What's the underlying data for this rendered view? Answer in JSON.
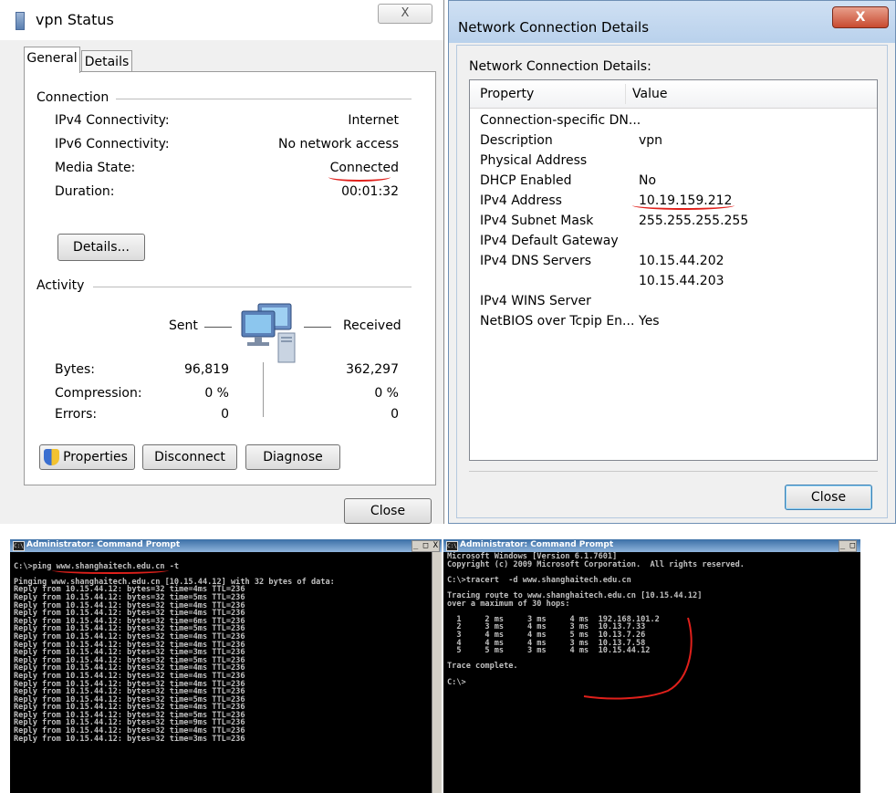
{
  "vpn_status": {
    "title": "vpn Status",
    "close_x": "X",
    "tabs": [
      "General",
      "Details"
    ],
    "connection": {
      "group_label": "Connection",
      "rows": [
        {
          "label": "IPv4 Connectivity:",
          "value": "Internet"
        },
        {
          "label": "IPv6 Connectivity:",
          "value": "No network access"
        },
        {
          "label": "Media State:",
          "value": "Connected"
        },
        {
          "label": "Duration:",
          "value": "00:01:32"
        }
      ],
      "details_button": "Details..."
    },
    "activity": {
      "group_label": "Activity",
      "sent_label": "Sent",
      "received_label": "Received",
      "rows": [
        {
          "label": "Bytes:",
          "sent": "96,819",
          "received": "362,297"
        },
        {
          "label": "Compression:",
          "sent": "0 %",
          "received": "0 %"
        },
        {
          "label": "Errors:",
          "sent": "0",
          "received": "0"
        }
      ]
    },
    "buttons": {
      "properties": "Properties",
      "disconnect": "Disconnect",
      "diagnose": "Diagnose",
      "close": "Close"
    }
  },
  "network_details": {
    "title": "Network Connection Details",
    "close_x": "X",
    "subtitle": "Network Connection Details:",
    "columns": [
      "Property",
      "Value"
    ],
    "rows": [
      {
        "property": "Connection-specific DN...",
        "value": ""
      },
      {
        "property": "Description",
        "value": "vpn"
      },
      {
        "property": "Physical Address",
        "value": ""
      },
      {
        "property": "DHCP Enabled",
        "value": "No"
      },
      {
        "property": "IPv4 Address",
        "value": "10.19.159.212"
      },
      {
        "property": "IPv4 Subnet Mask",
        "value": "255.255.255.255"
      },
      {
        "property": "IPv4 Default Gateway",
        "value": ""
      },
      {
        "property": "IPv4 DNS Servers",
        "value": "10.15.44.202"
      },
      {
        "property": "",
        "value": "10.15.44.203"
      },
      {
        "property": "IPv4 WINS Server",
        "value": ""
      },
      {
        "property": "NetBIOS over Tcpip En...",
        "value": "Yes"
      }
    ],
    "close_button": "Close"
  },
  "console_left": {
    "title": "Administrator: Command Prompt",
    "window_buttons": "_ □ X",
    "lines": [
      "",
      "C:\\>ping www.shanghaitech.edu.cn -t",
      "",
      "Pinging www.shanghaitech.edu.cn [10.15.44.12] with 32 bytes of data:",
      "Reply from 10.15.44.12: bytes=32 time=4ms TTL=236",
      "Reply from 10.15.44.12: bytes=32 time=5ms TTL=236",
      "Reply from 10.15.44.12: bytes=32 time=4ms TTL=236",
      "Reply from 10.15.44.12: bytes=32 time=4ms TTL=236",
      "Reply from 10.15.44.12: bytes=32 time=6ms TTL=236",
      "Reply from 10.15.44.12: bytes=32 time=5ms TTL=236",
      "Reply from 10.15.44.12: bytes=32 time=4ms TTL=236",
      "Reply from 10.15.44.12: bytes=32 time=4ms TTL=236",
      "Reply from 10.15.44.12: bytes=32 time=3ms TTL=236",
      "Reply from 10.15.44.12: bytes=32 time=5ms TTL=236",
      "Reply from 10.15.44.12: bytes=32 time=4ms TTL=236",
      "Reply from 10.15.44.12: bytes=32 time=4ms TTL=236",
      "Reply from 10.15.44.12: bytes=32 time=4ms TTL=236",
      "Reply from 10.15.44.12: bytes=32 time=4ms TTL=236",
      "Reply from 10.15.44.12: bytes=32 time=5ms TTL=236",
      "Reply from 10.15.44.12: bytes=32 time=4ms TTL=236",
      "Reply from 10.15.44.12: bytes=32 time=5ms TTL=236",
      "Reply from 10.15.44.12: bytes=32 time=9ms TTL=236",
      "Reply from 10.15.44.12: bytes=32 time=4ms TTL=236",
      "Reply from 10.15.44.12: bytes=32 time=3ms TTL=236"
    ]
  },
  "console_right": {
    "title": "Administrator: Command Prompt",
    "window_buttons": "_ □",
    "lines": [
      "Microsoft Windows [Version 6.1.7601]",
      "Copyright (c) 2009 Microsoft Corporation.  All rights reserved.",
      "",
      "C:\\>tracert  -d www.shanghaitech.edu.cn",
      "",
      "Tracing route to www.shanghaitech.edu.cn [10.15.44.12]",
      "over a maximum of 30 hops:",
      "",
      "  1     2 ms     3 ms     4 ms  192.168.101.2",
      "  2     3 ms     4 ms     3 ms  10.13.7.33",
      "  3     4 ms     4 ms     5 ms  10.13.7.26",
      "  4     4 ms     4 ms     3 ms  10.13.7.58",
      "  5     5 ms     3 ms     4 ms  10.15.44.12",
      "",
      "Trace complete.",
      "",
      "C:\\>"
    ]
  },
  "colors": {
    "annotation": "#e0201b",
    "console_bg": "#000000",
    "console_text": "#c0c0c0"
  }
}
